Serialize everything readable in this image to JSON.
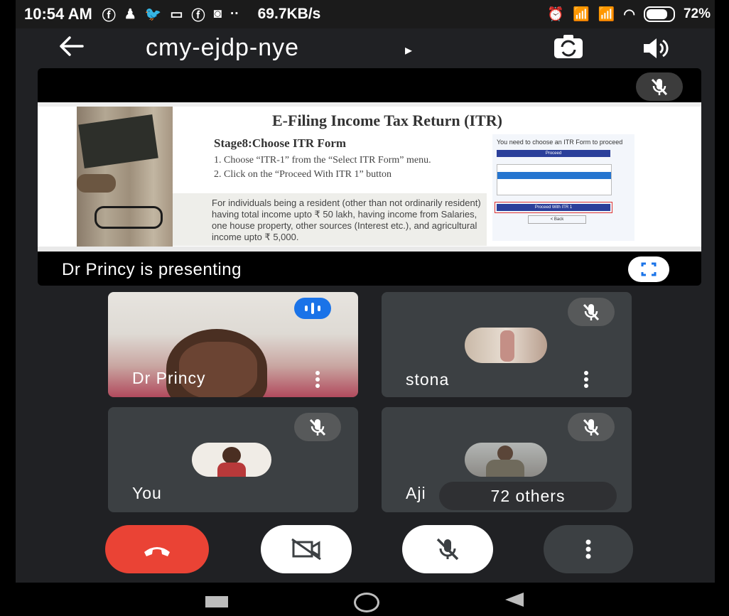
{
  "status_bar": {
    "time": "10:54 AM",
    "net_speed": "69.7KB/s",
    "battery": "72%",
    "battery_level": 0.72
  },
  "header": {
    "meeting_code": "cmy-ejdp-nye",
    "caret": "▸"
  },
  "presentation": {
    "slide": {
      "title": "E-Filing Income Tax Return (ITR)",
      "stage": "Stage8:Choose ITR  Form",
      "steps": [
        "1.   Choose “ITR-1” from the “Select ITR Form” menu.",
        "2.   Click on the “Proceed With ITR 1” button"
      ],
      "note": "For individuals being a resident (other than not ordinarily resident) having total income upto ₹ 50 lakh, having income from Salaries, one house property, other sources (Interest etc.), and agricultural income upto ₹ 5,000.",
      "panel_heading": "You need to choose an ITR Form to proceed",
      "proceed_label": "Proceed",
      "proceed_itr_label": "Proceed With ITR 1",
      "back_label": "< Back"
    },
    "presenting_label": "Dr Princy is presenting"
  },
  "participants": [
    {
      "name": "Dr Princy"
    },
    {
      "name": "stona"
    },
    {
      "name": "You"
    },
    {
      "name": "Aji"
    }
  ],
  "others_label": "72 others",
  "colors": {
    "background": "#202124",
    "tile": "#3c4043",
    "end_call": "#ea4335",
    "speaking": "#1a73e8"
  },
  "icons": [
    "back-arrow-icon",
    "switch-camera-icon",
    "speaker-icon",
    "mic-off-icon",
    "fullscreen-icon",
    "speaking-icon",
    "more-vert-icon",
    "end-call-icon",
    "camera-off-icon"
  ]
}
